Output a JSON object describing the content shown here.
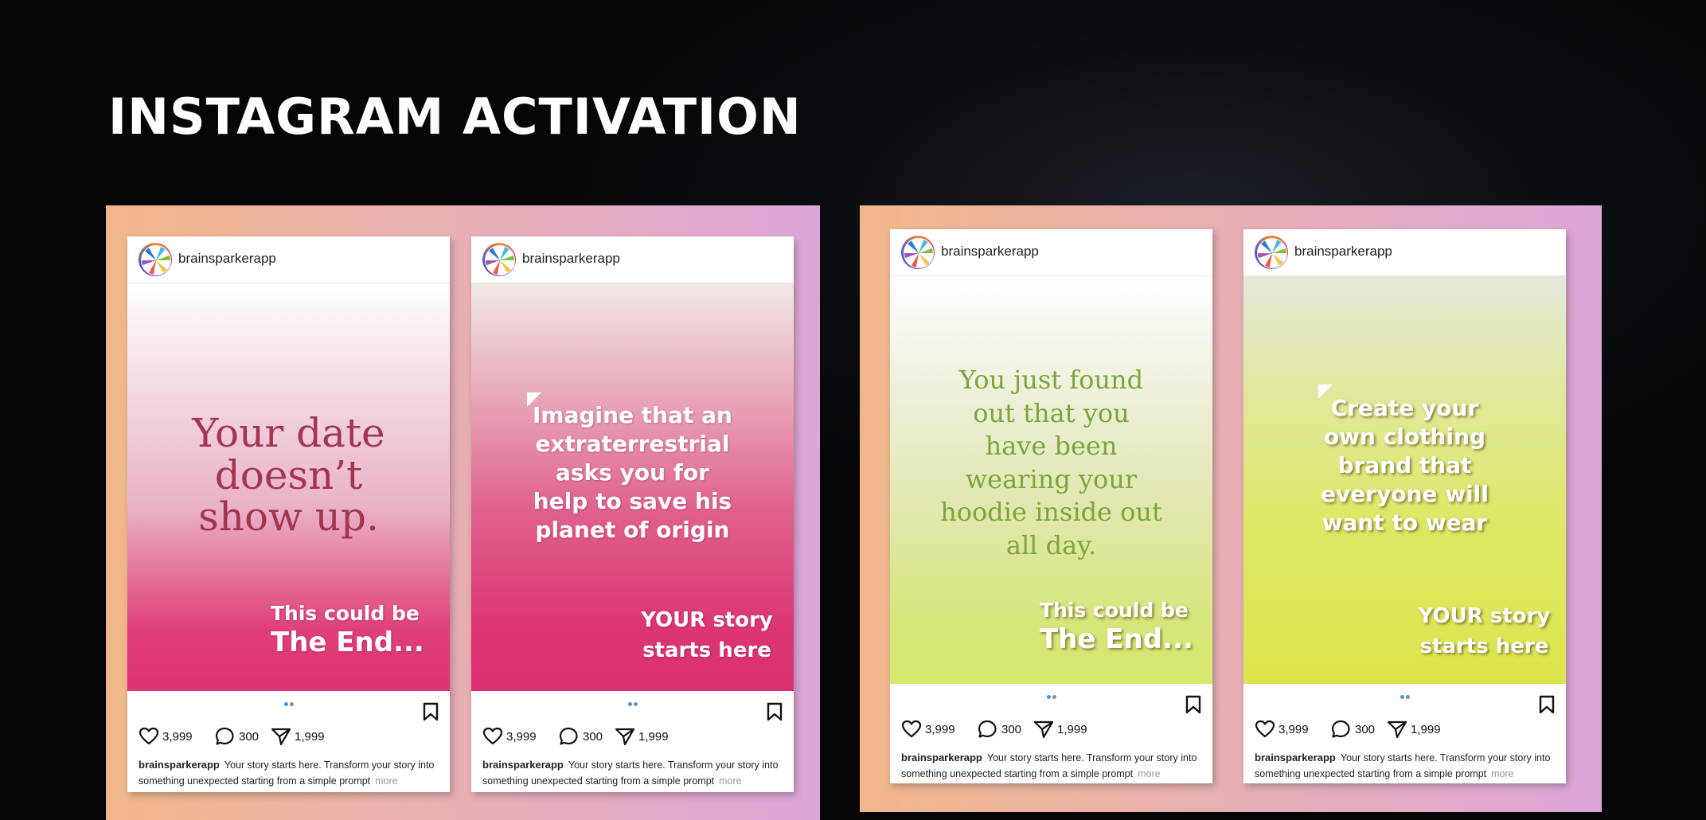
{
  "title": "INSTAGRAM ACTIVATION",
  "posts": [
    {
      "username": "brainsparkerapp",
      "prompt": [
        "Your date",
        "doesn’t",
        "show up."
      ],
      "tagline_top": "This could be",
      "tagline_bottom": "The End...",
      "likes": "3,999",
      "comments": "300",
      "shares": "1,999",
      "caption_user": "brainsparkerapp",
      "caption_text": "Your story starts here. Transform your story into something unexpected starting from a simple prompt",
      "caption_more": "more"
    },
    {
      "username": "brainsparkerapp",
      "prompt": [
        "Imagine that an",
        "extraterrestrial",
        "asks you for",
        "help to save his",
        "planet of origin"
      ],
      "tagline_top": "YOUR story",
      "tagline_bottom": "starts here",
      "likes": "3,999",
      "comments": "300",
      "shares": "1,999",
      "caption_user": "brainsparkerapp",
      "caption_text": "Your story starts here. Transform your story into something unexpected starting from a simple prompt",
      "caption_more": "more"
    },
    {
      "username": "brainsparkerapp",
      "prompt": [
        "You just found",
        "out that you",
        "have been",
        "wearing your",
        "hoodie inside out",
        "all day."
      ],
      "tagline_top": "This could be",
      "tagline_bottom": "The End...",
      "likes": "3,999",
      "comments": "300",
      "shares": "1,999",
      "caption_user": "brainsparkerapp",
      "caption_text": "Your story starts here. Transform your story into something unexpected starting from a simple prompt",
      "caption_more": "more"
    },
    {
      "username": "brainsparkerapp",
      "prompt": [
        "Create your",
        "own clothing",
        "brand that",
        "everyone will",
        "want to wear"
      ],
      "tagline_top": "YOUR story",
      "tagline_bottom": "starts here",
      "likes": "3,999",
      "comments": "300",
      "shares": "1,999",
      "caption_user": "brainsparkerapp",
      "caption_text": "Your story starts here. Transform your story into something unexpected starting from a simple prompt",
      "caption_more": "more"
    }
  ],
  "colors": {
    "pink_text": "#a33452",
    "green_text": "#7aa63a",
    "like_blue": "#3897f0"
  },
  "icons": [
    "heart-icon",
    "comment-icon",
    "share-icon",
    "bookmark-icon",
    "carousel-dots"
  ]
}
